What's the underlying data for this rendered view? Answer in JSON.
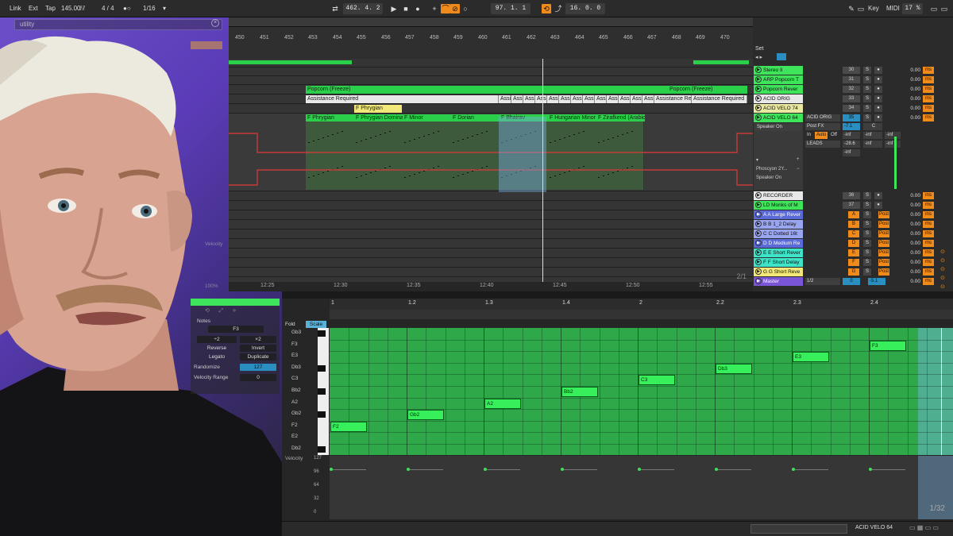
{
  "transport": {
    "link": "Link",
    "ext": "Ext",
    "tap": "Tap",
    "tempo": "145.00",
    "signature": "4 / 4",
    "metro": "1 Bar",
    "quantize": "1/16",
    "position": "462.  4.  2",
    "loop_start": "97.  1.  1",
    "loop_len": "16.  0.  0",
    "key": "Key",
    "midi": "MIDI",
    "cpu": "17 %",
    "hw_h": "H",
    "hw_w": "W"
  },
  "browser_ghost": {
    "search": "utility",
    "close": "×"
  },
  "arrangement": {
    "bars": [
      "450",
      "451",
      "452",
      "453",
      "454",
      "455",
      "456",
      "457",
      "458",
      "459",
      "460",
      "461",
      "462",
      "463",
      "464",
      "465",
      "466",
      "467",
      "468",
      "469",
      "470"
    ],
    "times": [
      "12:25",
      "12:30",
      "12:35",
      "12:40",
      "12:45",
      "12:50",
      "12:55"
    ],
    "scroll_label": "2/1",
    "clips": {
      "popcorn_freeze": "Popcorn (Freeze)",
      "popcorn_freeze_2": "Popcorn (Freeze)",
      "assistance": "Assistance Required",
      "assist_short": "Assi",
      "assistance_req": "Assistance Req",
      "assistance_required_2": "Assistance Required",
      "phrygian_yellow": "F Phrygian",
      "scales": [
        "F Phrygian",
        "F Phrygian Domina",
        "F Minor",
        "F Dorian",
        "F Bhairav",
        "F Hungarian Minor",
        "F Zirafkend (Arabic"
      ]
    }
  },
  "mixer": {
    "set_label": "Set",
    "tracks": [
      {
        "name": "Stereo II",
        "num": "30",
        "vol": "0.00",
        "color": "#3ee45a"
      },
      {
        "name": "ARP Popcorn T",
        "num": "31",
        "vol": "0.00",
        "color": "#3ee45a"
      },
      {
        "name": "Popcorn Rever",
        "num": "32",
        "vol": "0.00",
        "color": "#3ee45a"
      },
      {
        "name": "ACID ORIG",
        "num": "33",
        "vol": "0.00",
        "color": "#e8e8e8"
      },
      {
        "name": "ACID VELO 74",
        "num": "34",
        "vol": "0.00",
        "color": "#e8e8a0"
      },
      {
        "name": "ACID VELO 64",
        "num": "35",
        "vol": "0.00",
        "color": "#3ee45a"
      }
    ],
    "selected_track": {
      "monitor": "Speaker On",
      "input": "ACID ORIG",
      "input_sub": "Post FX",
      "vol_db": "-7.1",
      "pan": "C",
      "monitor_in": "In",
      "monitor_auto": "Auto",
      "monitor_off": "Off",
      "output": "LEADS",
      "out_val": "-28.6",
      "inf1": "-inf",
      "inf2": "-inf",
      "inf3": "-inf",
      "inf4": "-inf",
      "inf5": "-inf",
      "inf6": "-inf",
      "device": "Phoscyon 2Y...",
      "device_state": "Speaker On"
    },
    "lower_tracks": [
      {
        "name": "RECORDER",
        "num": "36",
        "vol": "0.00",
        "color": "#e8e8e8"
      },
      {
        "name": "LD Monks of M",
        "num": "37",
        "vol": "0.00",
        "color": "#3ee45a"
      }
    ],
    "returns": [
      {
        "name": "A A Large Rever",
        "letter": "A",
        "post": "Post",
        "vol": "0.00"
      },
      {
        "name": "B B 1_2 Delay",
        "letter": "B",
        "post": "Post",
        "vol": "0.00"
      },
      {
        "name": "C C Dotted 16t",
        "letter": "C",
        "post": "Post",
        "vol": "0.00"
      },
      {
        "name": "D D Medium Re",
        "letter": "D",
        "post": "Post",
        "vol": "0.00"
      },
      {
        "name": "E E Short Rever",
        "letter": "E",
        "post": "Post",
        "vol": "0.00"
      },
      {
        "name": "F F Short Delay",
        "letter": "F",
        "post": "Post",
        "vol": "0.00"
      },
      {
        "name": "G G Short Reve",
        "letter": "G",
        "post": "Post",
        "vol": "0.00"
      }
    ],
    "master": {
      "name": "Master",
      "out": "1/2",
      "num": "0",
      "vol": "-5.1",
      "vol2": "0.00"
    },
    "ms_label": "ms",
    "solo": "S"
  },
  "clip_props": {
    "notes_label": "Notes",
    "note_val": "F3",
    "half": "÷2",
    "double": "×2",
    "reverse": "Reverse",
    "invert": "Invert",
    "legato": "Legato",
    "duplicate": "Duplicate",
    "randomize": "Randomize",
    "randomize_val": "127",
    "velocity_range": "Velocity Range",
    "velocity_range_val": "0",
    "percent": "100%",
    "velocity": "Velocity"
  },
  "midi": {
    "fold": "Fold",
    "scale": "Scale",
    "bars": [
      "1",
      "1.2",
      "1.3",
      "1.4",
      "2",
      "2.2",
      "2.3",
      "2.4"
    ],
    "note_rows": [
      "Gb3",
      "F3",
      "E3",
      "Db3",
      "C3",
      "Bb2",
      "A2",
      "Gb2",
      "F2",
      "E2",
      "Db2"
    ],
    "notes": [
      {
        "label": "F2",
        "row": 8,
        "step": 0
      },
      {
        "label": "Gb2",
        "row": 7,
        "step": 1
      },
      {
        "label": "A2",
        "row": 6,
        "step": 2
      },
      {
        "label": "Bb2",
        "row": 5,
        "step": 3
      },
      {
        "label": "C3",
        "row": 4,
        "step": 4
      },
      {
        "label": "Db3",
        "row": 3,
        "step": 5
      },
      {
        "label": "E3",
        "row": 2,
        "step": 6
      },
      {
        "label": "F3",
        "row": 1,
        "step": 7
      }
    ],
    "velocity_label": "Velocity",
    "vel_axis": [
      "127",
      "96",
      "64",
      "32",
      "0"
    ],
    "grid_label": "1/32"
  },
  "status": {
    "track": "ACID VELO 64"
  }
}
